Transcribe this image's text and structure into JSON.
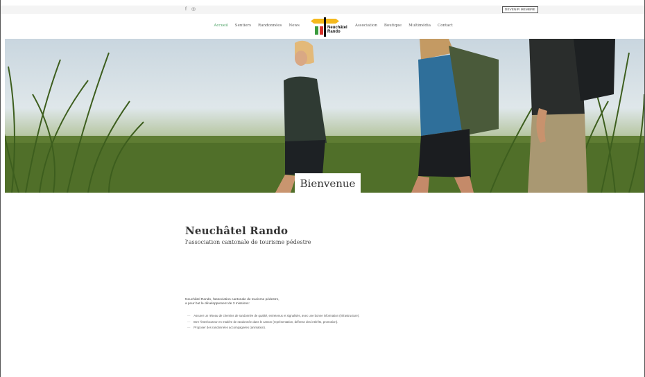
{
  "topbar": {
    "social_icons": [
      {
        "name": "facebook-icon",
        "glyph": "f"
      },
      {
        "name": "instagram-icon",
        "glyph": "◎"
      }
    ],
    "member_button": "DEVENIR MEMBRE"
  },
  "nav": {
    "left": [
      "Accueil",
      "Sentiers",
      "Randonnées",
      "News"
    ],
    "right": [
      "Association",
      "Boutique",
      "Multimédia",
      "Contact"
    ],
    "active": "Accueil",
    "logo_line1": "Neuchâtel",
    "logo_line2": "Rando"
  },
  "hero": {
    "welcome": "Bienvenue"
  },
  "content": {
    "title": "Neuchâtel Rando",
    "subtitle": "l'association cantonale de tourisme pédestre",
    "intro_line1": "Neuchâtel Rando, l'association cantonale de tourisme pédestre,",
    "intro_line2": "a pour but le développement de 3 missions:",
    "missions": [
      "Assurer un réseau de chemins de randonnée de qualité, entretenus et signalisés, avec une bonne information (infrastructure).",
      "Etre l'interlocuteur en matière de randonnée dans le canton (représentation, défense des intérêts, promotion).",
      "Proposer des randonnées accompagnées (animation)."
    ]
  },
  "colors": {
    "accent_green": "#3f9b5a",
    "logo_yellow": "#f4b81c",
    "flag_green": "#3a9b3e",
    "flag_red": "#d8322c"
  }
}
